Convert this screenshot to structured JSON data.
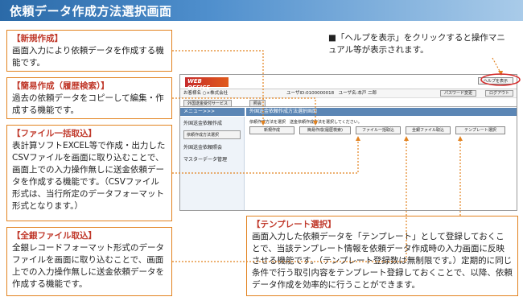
{
  "title": "依頼データ作成方法選択画面",
  "help_note": "■「ヘルプを表示」をクリックすると操作マニュアル等が表示されます。",
  "boxes": {
    "new": {
      "head": "【新規作成】",
      "body": "画面入力により依頼データを作成する機能です。"
    },
    "simple": {
      "head": "【簡易作成（履歴検索）】",
      "body": "過去の依頼データをコピーして編集・作成する機能です。"
    },
    "file": {
      "head": "【ファイル一括取込】",
      "body": "表計算ソフトEXCEL等で作成・出力したCSVファイルを画面に取り込むことで、画面上での入力操作無しに送金依頼データを作成する機能です。（CSVファイル形式は、当行所定のデータフォーマット形式となります。）"
    },
    "zengin": {
      "head": "【全銀ファイル取込】",
      "body": "全銀レコードフォーマット形式のデータファイルを画面に取り込むことで、画面上での入力操作無しに送金依頼データを作成する機能です。"
    },
    "template": {
      "head": "【テンプレート選択】",
      "body": "画面入力した依頼データを「テンプレート」として登録しておくことで、当該テンプレート情報を依頼データ作成時の入力画面に反映させる機能です。（テンプレート登録数は無制限です。）定期的に同じ条件で行う取引内容をテンプレート登録しておくことで、以降、依頼データ作成を効率的に行うことができます。"
    }
  },
  "shot": {
    "logo": "WEB OFFICE",
    "help_button": "ヘルプを表示",
    "company": "お客様名 ○×株式会社",
    "user_id": "ユーザID:0100000018　ユーザ名:本戸 二郎",
    "pw_button": "パスワード変更",
    "logout_button": "ログアウト",
    "tab1": "外国送金受付サービス",
    "tab2": "照会",
    "menu_head": "メニュー>>>",
    "page_head": "外国送金依頼作成方法選択画面",
    "side_title": "外国送金依頼作成",
    "side_button": "依頼作成方法選択",
    "side_item2": "外国送金依頼照会",
    "side_item3": "マスターデータ管理",
    "desc": "依頼作成方法を選択　送金依頼作成方法を選択してください。",
    "buttons": [
      "新規作成",
      "簡易作成(履歴検索)",
      "ファイル一括取込",
      "全銀ファイル取込",
      "テンプレート選択"
    ]
  }
}
